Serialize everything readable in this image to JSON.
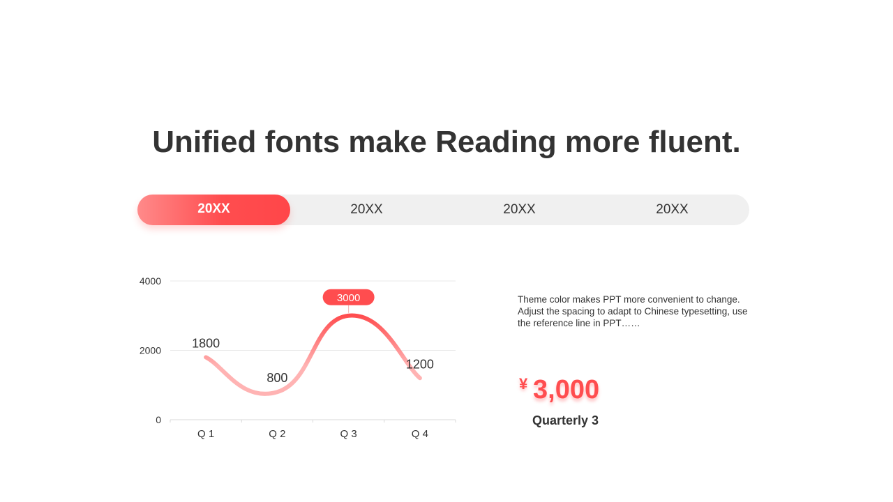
{
  "title": "Unified fonts make Reading more fluent.",
  "tabs": [
    {
      "label": "20XX",
      "active": true
    },
    {
      "label": "20XX",
      "active": false
    },
    {
      "label": "20XX",
      "active": false
    },
    {
      "label": "20XX",
      "active": false
    }
  ],
  "colors": {
    "accent": "#ff4d4f",
    "accent_light": "#ffb3b3",
    "tab_bg": "#f0f0f0",
    "text": "#333333"
  },
  "chart_data": {
    "type": "line",
    "categories": [
      "Q 1",
      "Q 2",
      "Q 3",
      "Q 4"
    ],
    "values": [
      1800,
      800,
      3000,
      1200
    ],
    "data_labels": [
      "1800",
      "800",
      "3000",
      "1200"
    ],
    "highlight_label_index": 2,
    "y_ticks": [
      0,
      2000,
      4000
    ],
    "ylim": [
      0,
      4000
    ],
    "grid": true,
    "smooth": true,
    "legend": "none"
  },
  "description": {
    "line1": "Theme color makes PPT more convenient to change.",
    "line2": "Adjust the spacing to adapt to Chinese typesetting, use the reference line in PPT……"
  },
  "stat": {
    "currency": "¥",
    "value": "3,000",
    "label": "Quarterly 3"
  }
}
